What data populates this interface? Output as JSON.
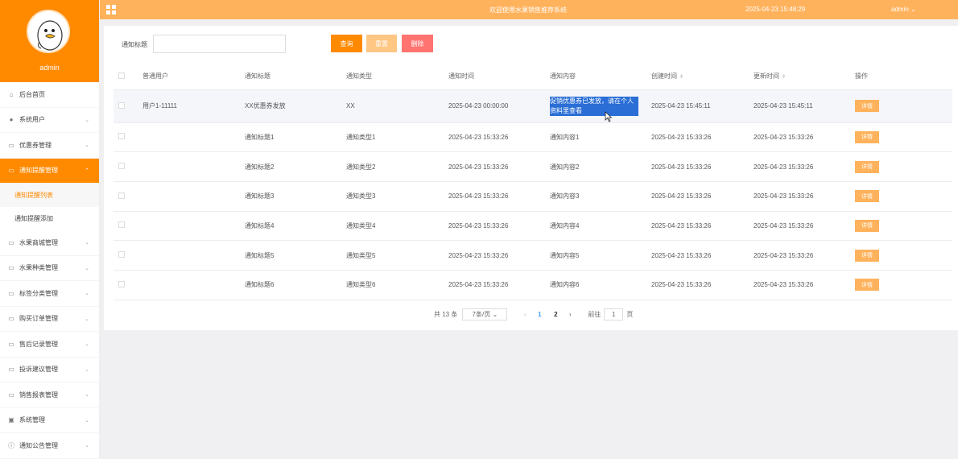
{
  "brand": {
    "name": "admin"
  },
  "topbar": {
    "title": "欢迎使用水果销售推荐系统",
    "datetime": "2025-04-23 15:48:29",
    "user": "admin"
  },
  "sidebar": {
    "items": [
      {
        "label": "后台首页",
        "icon": "home-icon",
        "expandable": false
      },
      {
        "label": "系统用户",
        "icon": "user-icon",
        "expandable": true
      },
      {
        "label": "优惠券管理",
        "icon": "doc-icon",
        "expandable": true
      },
      {
        "label": "通知提醒管理",
        "icon": "doc-icon",
        "expandable": true,
        "active": true
      },
      {
        "label": "水果商城管理",
        "icon": "doc-icon",
        "expandable": true
      },
      {
        "label": "水果种类管理",
        "icon": "doc-icon",
        "expandable": true
      },
      {
        "label": "标签分类管理",
        "icon": "doc-icon",
        "expandable": true
      },
      {
        "label": "购买订单管理",
        "icon": "doc-icon",
        "expandable": true
      },
      {
        "label": "售后记录管理",
        "icon": "doc-icon",
        "expandable": true
      },
      {
        "label": "投诉建议管理",
        "icon": "doc-icon",
        "expandable": true
      },
      {
        "label": "销售报表管理",
        "icon": "doc-icon",
        "expandable": true
      },
      {
        "label": "系统管理",
        "icon": "settings-icon",
        "expandable": true
      },
      {
        "label": "通知公告管理",
        "icon": "info-icon",
        "expandable": true
      }
    ],
    "subitems": [
      {
        "label": "通知提醒列表",
        "current": true
      },
      {
        "label": "通知提醒添加",
        "current": false
      }
    ]
  },
  "search": {
    "label": "通知标题",
    "value": "",
    "query_label": "查询",
    "reset_label": "重置",
    "delete_label": "删除"
  },
  "table": {
    "headers": [
      "普通用户",
      "通知标题",
      "通知类型",
      "通知时间",
      "通知内容",
      "创建时间",
      "更新时间",
      "操作"
    ],
    "rows": [
      [
        "用户1-11111",
        "XX优惠券发放",
        "XX",
        "2025-04-23 00:00:00",
        "促销优惠券已发放，请在个人资料里查看",
        "2025-04-23 15:45:11",
        "2025-04-23 15:45:11",
        "详情"
      ],
      [
        "",
        "通知标题1",
        "通知类型1",
        "2025-04-23 15:33:26",
        "通知内容1",
        "2025-04-23 15:33:26",
        "2025-04-23 15:33:26",
        "详情"
      ],
      [
        "",
        "通知标题2",
        "通知类型2",
        "2025-04-23 15:33:26",
        "通知内容2",
        "2025-04-23 15:33:26",
        "2025-04-23 15:33:26",
        "详情"
      ],
      [
        "",
        "通知标题3",
        "通知类型3",
        "2025-04-23 15:33:26",
        "通知内容3",
        "2025-04-23 15:33:26",
        "2025-04-23 15:33:26",
        "详情"
      ],
      [
        "",
        "通知标题4",
        "通知类型4",
        "2025-04-23 15:33:26",
        "通知内容4",
        "2025-04-23 15:33:26",
        "2025-04-23 15:33:26",
        "详情"
      ],
      [
        "",
        "通知标题5",
        "通知类型5",
        "2025-04-23 15:33:26",
        "通知内容5",
        "2025-04-23 15:33:26",
        "2025-04-23 15:33:26",
        "详情"
      ],
      [
        "",
        "通知标题6",
        "通知类型6",
        "2025-04-23 15:33:26",
        "通知内容6",
        "2025-04-23 15:33:26",
        "2025-04-23 15:33:26",
        "详情"
      ]
    ]
  },
  "pagination": {
    "total": "共 13 条",
    "page_size": "7条/页",
    "pages": [
      "1",
      "2"
    ],
    "current": "1",
    "goto_prefix": "前往",
    "goto_value": "1",
    "goto_suffix": "页"
  },
  "colors": {
    "accent": "#ff8a00",
    "topbar": "#ffb25c",
    "danger": "#ff7470"
  }
}
